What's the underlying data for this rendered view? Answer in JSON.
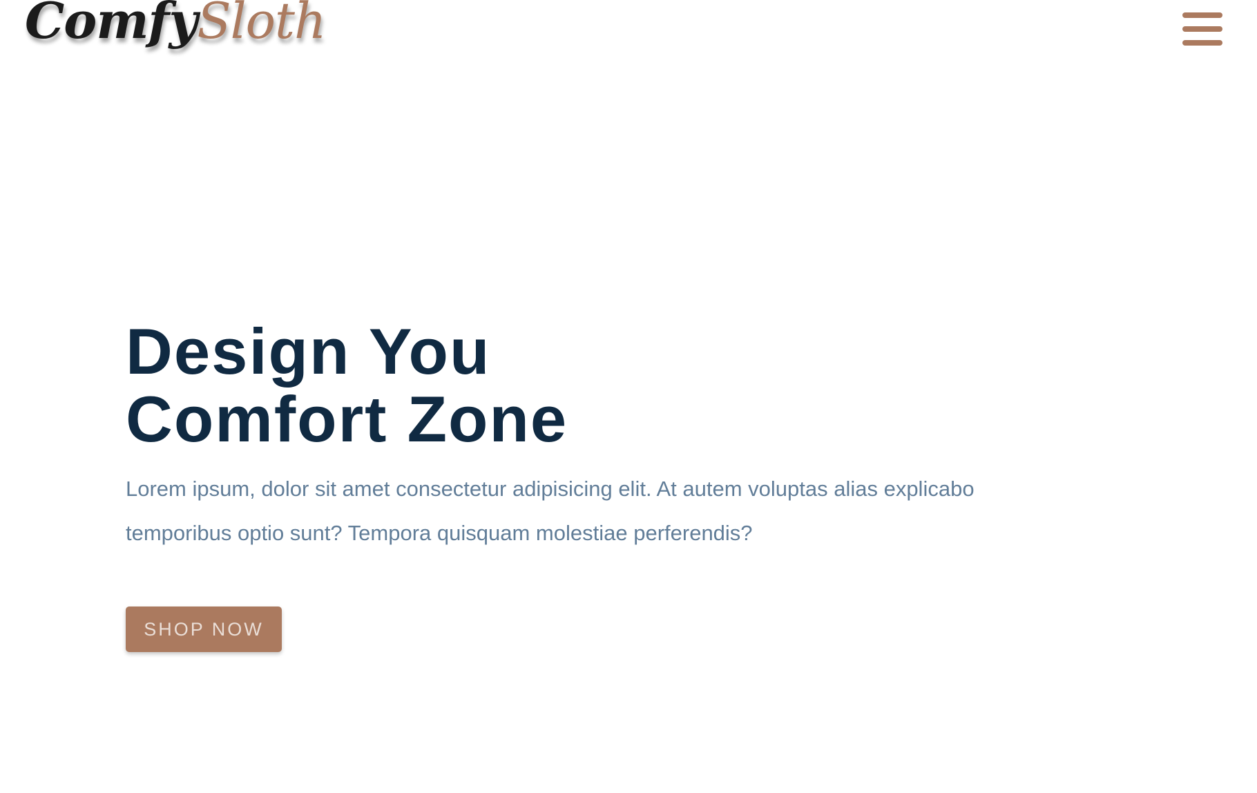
{
  "navbar": {
    "logo": {
      "part1": "Comfy",
      "part2": "Sloth"
    },
    "menu_icon": "hamburger-menu-icon"
  },
  "hero": {
    "title_line1": "Design You",
    "title_line2": "Comfort Zone",
    "text": "Lorem ipsum, dolor sit amet consectetur adipisicing elit. At autem voluptas alias explicabo temporibus optio sunt? Tempora quisquam molestiae perferendis?",
    "button_label": "Shop Now"
  },
  "colors": {
    "brand": "#ab7a5f",
    "heading": "#102a42",
    "body_text": "#617d98",
    "logo_dark": "#1b1b1b",
    "button_text": "#eaded7",
    "background": "#ffffff"
  }
}
